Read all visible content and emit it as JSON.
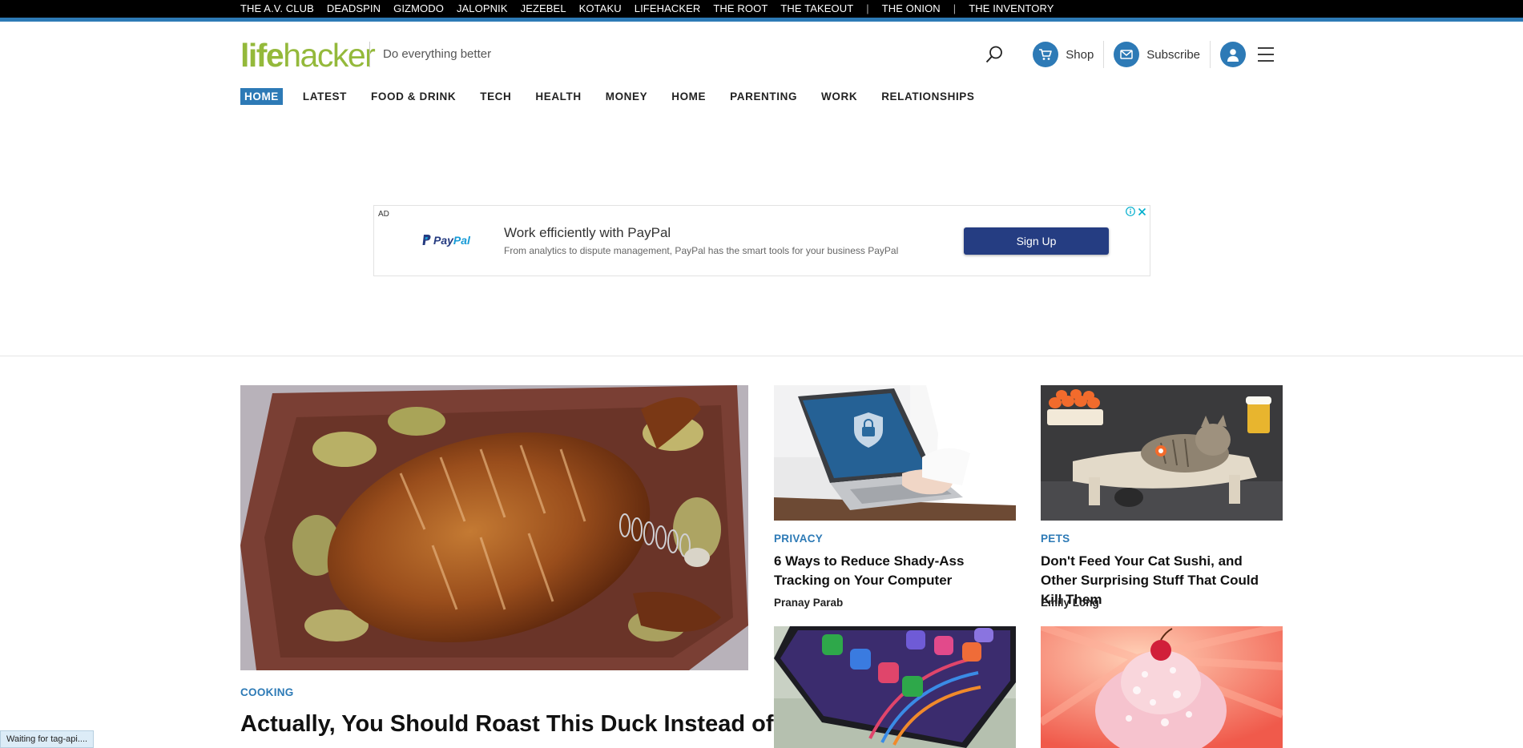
{
  "network_bar": {
    "group1": [
      "THE A.V. CLUB",
      "DEADSPIN",
      "GIZMODO",
      "JALOPNIK",
      "JEZEBEL",
      "KOTAKU",
      "LIFEHACKER",
      "THE ROOT",
      "THE TAKEOUT"
    ],
    "group2": [
      "THE ONION"
    ],
    "group3": [
      "THE INVENTORY"
    ]
  },
  "header": {
    "logo_part1": "life",
    "logo_part2": "hacker",
    "tagline": "Do everything better",
    "shop_label": "Shop",
    "subscribe_label": "Subscribe"
  },
  "nav": [
    "HOME",
    "LATEST",
    "FOOD & DRINK",
    "TECH",
    "HEALTH",
    "MONEY",
    "HOME",
    "PARENTING",
    "WORK",
    "RELATIONSHIPS"
  ],
  "ad": {
    "label": "AD",
    "brand_part1": "Pay",
    "brand_part2": "Pal",
    "headline": "Work efficiently with PayPal",
    "description": "From analytics to dispute management, PayPal has the smart tools for your business PayPal",
    "cta": "Sign Up"
  },
  "stories": {
    "featured": {
      "category": "COOKING",
      "headline": "Actually, You Should Roast This Duck Instead of a"
    },
    "card1": {
      "category": "PRIVACY",
      "headline": "6 Ways to Reduce Shady-Ass Tracking on Your Computer",
      "author": "Pranay Parab"
    },
    "card2": {
      "category": "PETS",
      "headline": "Don't Feed Your Cat Sushi, and Other Surprising Stuff That Could Kill Them",
      "author": "Emily Long"
    }
  },
  "status_bar": "Waiting for tag-api....",
  "colors": {
    "accent": "#2d7ab6",
    "logo_green": "#94b93b",
    "paypal_navy": "#253d82"
  }
}
